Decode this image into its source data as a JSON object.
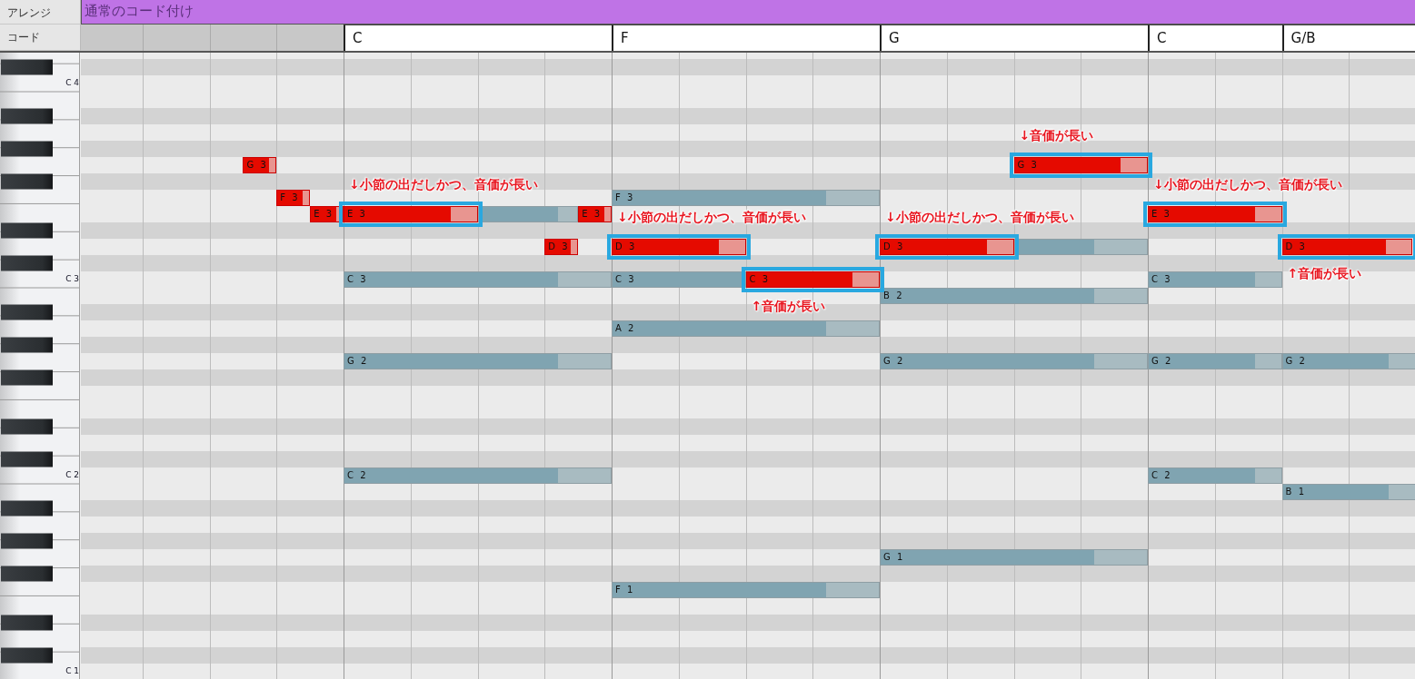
{
  "tracks": {
    "arrange_label": "アレンジ",
    "chord_label": "コード"
  },
  "arrange": {
    "label": "通常のコード付け"
  },
  "chords": [
    {
      "label": "C"
    },
    {
      "label": "F"
    },
    {
      "label": "G"
    },
    {
      "label": "C"
    },
    {
      "label": "G/B"
    }
  ],
  "keyboard": {
    "octave_labels": [
      "C 4",
      "C 3",
      "C 2",
      "C 1"
    ]
  },
  "notes": [
    {
      "kind": "chord"
    },
    {
      "kind": "chord",
      "label": "C 3"
    },
    {
      "kind": "chord",
      "label": "G 2"
    },
    {
      "kind": "chord",
      "label": "C 2"
    },
    {
      "kind": "chord",
      "label": "F 3"
    },
    {
      "kind": "chord",
      "label": "C 3"
    },
    {
      "kind": "chord",
      "label": "A 2"
    },
    {
      "kind": "chord",
      "label": "F 1"
    },
    {
      "kind": "chord"
    },
    {
      "kind": "chord",
      "label": "B 2"
    },
    {
      "kind": "chord",
      "label": "G 2"
    },
    {
      "kind": "chord",
      "label": "G 1"
    },
    {
      "kind": "chord",
      "label": "C 3"
    },
    {
      "kind": "chord",
      "label": "G 2"
    },
    {
      "kind": "chord",
      "label": "C 2"
    },
    {
      "kind": "chord",
      "label": "G 2"
    },
    {
      "kind": "chord",
      "label": "B 1"
    },
    {
      "kind": "melody",
      "label": "G 3",
      "highlighted": false
    },
    {
      "kind": "melody",
      "label": "F 3",
      "highlighted": false
    },
    {
      "kind": "melody",
      "label": "E 3",
      "highlighted": false
    },
    {
      "kind": "melody",
      "label": "E 3",
      "highlighted": true,
      "annotation": {
        "text": "↓小節の出だしかつ、音価が長い"
      }
    },
    {
      "kind": "melody",
      "label": "D 3",
      "highlighted": false
    },
    {
      "kind": "melody",
      "label": "E 3",
      "highlighted": false
    },
    {
      "kind": "melody",
      "label": "D 3",
      "highlighted": true,
      "annotation": {
        "text": "↓小節の出だしかつ、音価が長い"
      }
    },
    {
      "kind": "melody",
      "label": "C 3",
      "highlighted": true,
      "annotation": {
        "text": "↑音価が長い"
      }
    },
    {
      "kind": "melody",
      "label": "G 3",
      "highlighted": true,
      "annotation": {
        "text": "↓音価が長い"
      }
    },
    {
      "kind": "melody",
      "label": "D 3",
      "highlighted": true,
      "annotation": {
        "text": "↓小節の出だしかつ、音価が長い"
      }
    },
    {
      "kind": "melody",
      "label": "E 3",
      "highlighted": true,
      "annotation": {
        "text": "↓小節の出だしかつ、音価が長い"
      }
    },
    {
      "kind": "melody",
      "label": "D 3",
      "highlighted": true,
      "annotation": {
        "text": "↑音価が長い"
      }
    }
  ]
}
